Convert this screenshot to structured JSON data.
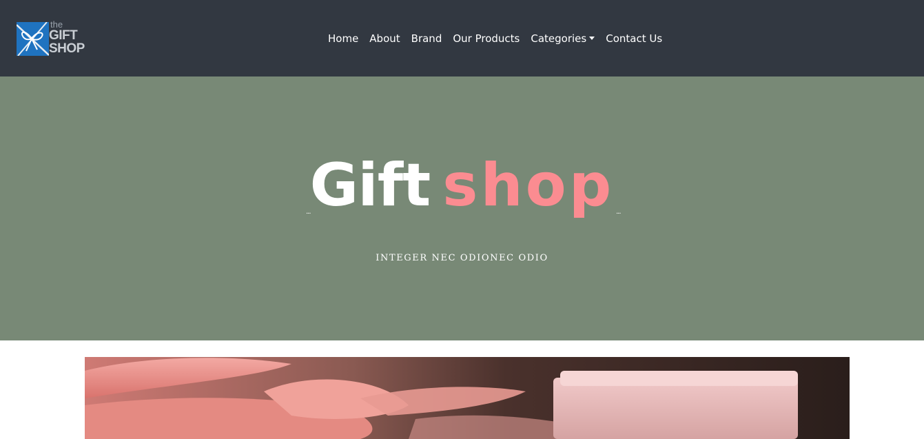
{
  "logo": {
    "the": "the",
    "gift": "GIFT",
    "shop": "SHOP"
  },
  "nav": {
    "items": [
      {
        "label": "Home"
      },
      {
        "label": "About"
      },
      {
        "label": "Brand"
      },
      {
        "label": "Our Products"
      },
      {
        "label": "Categories"
      },
      {
        "label": "Contact Us"
      }
    ]
  },
  "hero": {
    "title_part1": "Gift",
    "title_part2": "shop",
    "dots_left": "...",
    "dots_right": "...",
    "subtitle": "INTEGER NEC ODIONEC ODIO"
  },
  "colors": {
    "navbar": "#323841",
    "hero_background": "#788976",
    "accent_pink": "#fb8c91",
    "logo_blue": "#1f73c0"
  }
}
